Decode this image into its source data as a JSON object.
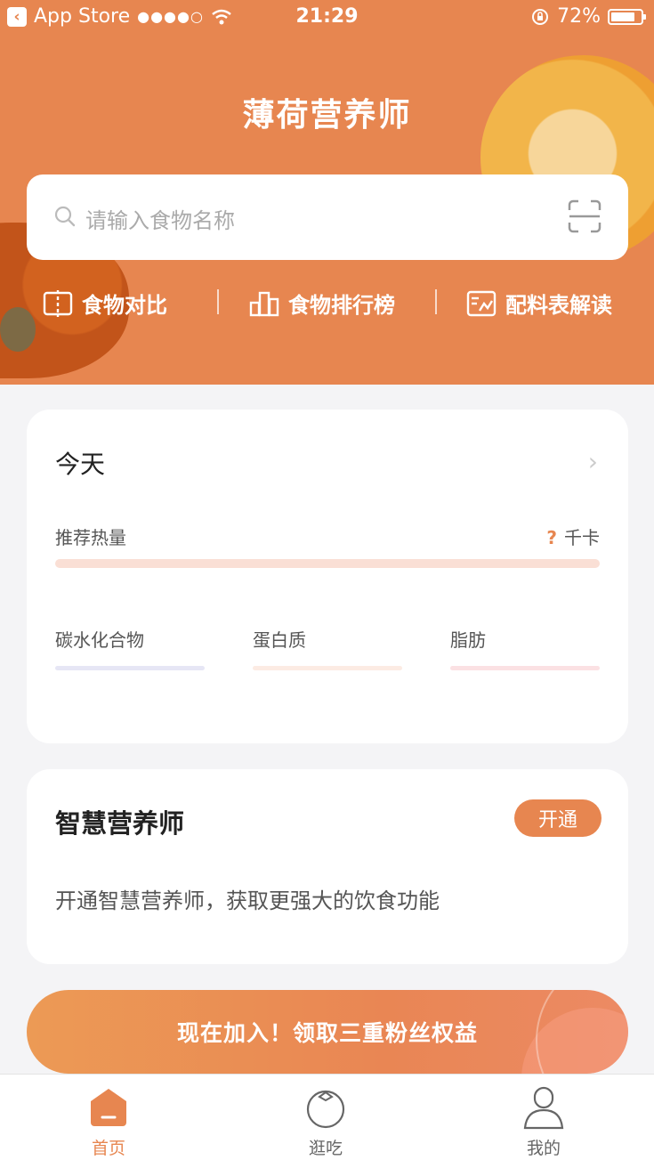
{
  "status_bar": {
    "back_app": "App Store",
    "signal": "●●●●○",
    "time": "21:29",
    "battery": "72%"
  },
  "header": {
    "title": "薄荷营养师"
  },
  "search": {
    "placeholder": "请输入食物名称"
  },
  "quick_links": [
    {
      "label": "食物对比",
      "icon": "compare-icon"
    },
    {
      "label": "食物排行榜",
      "icon": "ranking-icon"
    },
    {
      "label": "配料表解读",
      "icon": "ingredient-icon"
    }
  ],
  "today": {
    "title": "今天",
    "kcal_label": "推荐热量",
    "kcal_value": "?",
    "kcal_unit": "千卡",
    "macros": [
      {
        "label": "碳水化合物",
        "color": "#e6e6f5"
      },
      {
        "label": "蛋白质",
        "color": "#fcebe3"
      },
      {
        "label": "脂肪",
        "color": "#fbe1e3"
      }
    ]
  },
  "smart": {
    "title": "智慧营养师",
    "button": "开通",
    "desc": "开通智慧营养师，获取更强大的饮食功能"
  },
  "banner": {
    "text": "现在加入！领取三重粉丝权益"
  },
  "tabs": [
    {
      "label": "首页",
      "icon": "home-icon",
      "active": true
    },
    {
      "label": "逛吃",
      "icon": "explore-icon",
      "active": false
    },
    {
      "label": "我的",
      "icon": "profile-icon",
      "active": false
    }
  ],
  "colors": {
    "accent": "#e78650",
    "background": "#f4f4f6"
  }
}
